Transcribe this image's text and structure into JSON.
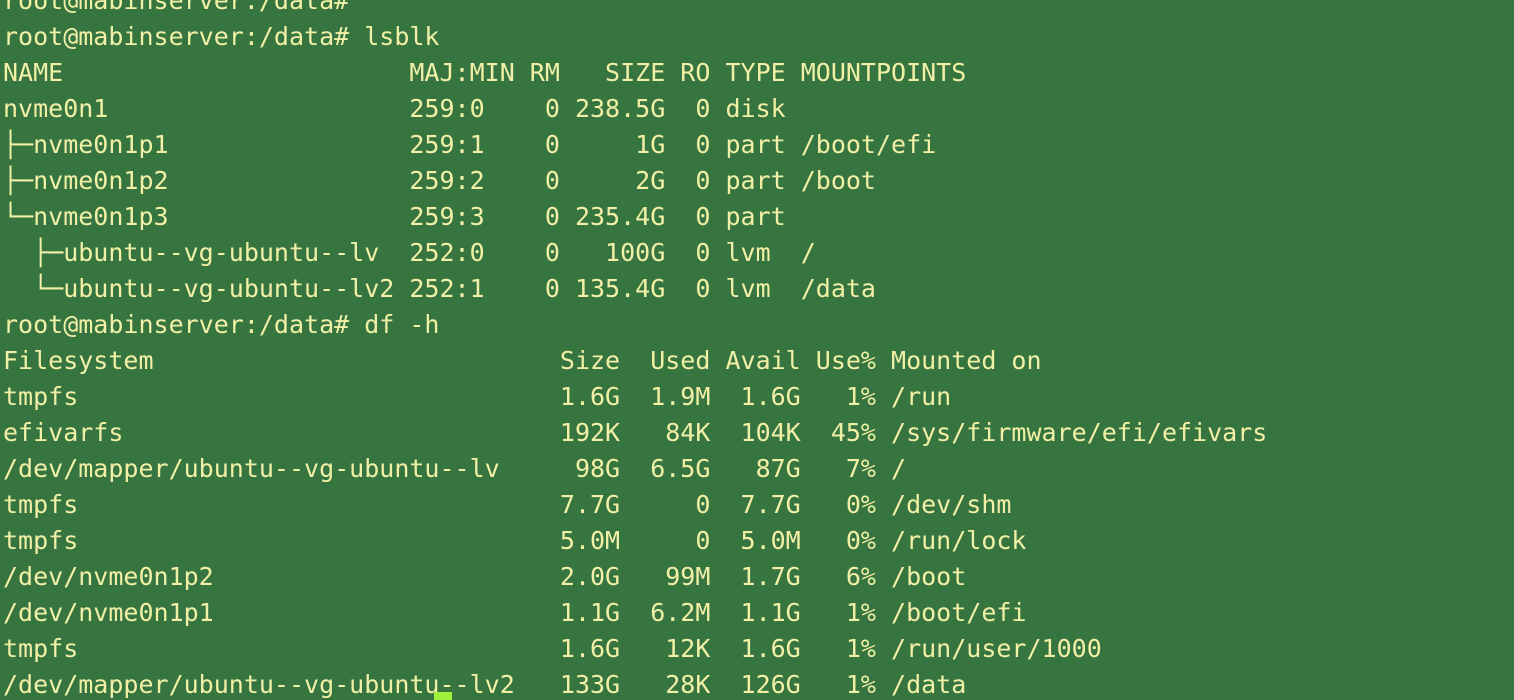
{
  "terminal": {
    "lines": [
      "root@mabinserver:/data#",
      "root@mabinserver:/data# lsblk",
      "NAME                       MAJ:MIN RM   SIZE RO TYPE MOUNTPOINTS",
      "nvme0n1                    259:0    0 238.5G  0 disk",
      "├─nvme0n1p1                259:1    0     1G  0 part /boot/efi",
      "├─nvme0n1p2                259:2    0     2G  0 part /boot",
      "└─nvme0n1p3                259:3    0 235.4G  0 part",
      "  ├─ubuntu--vg-ubuntu--lv  252:0    0   100G  0 lvm  /",
      "  └─ubuntu--vg-ubuntu--lv2 252:1    0 135.4G  0 lvm  /data",
      "root@mabinserver:/data# df -h",
      "Filesystem                           Size  Used Avail Use% Mounted on",
      "tmpfs                                1.6G  1.9M  1.6G   1% /run",
      "efivarfs                             192K   84K  104K  45% /sys/firmware/efi/efivars",
      "/dev/mapper/ubuntu--vg-ubuntu--lv     98G  6.5G   87G   7% /",
      "tmpfs                                7.7G     0  7.7G   0% /dev/shm",
      "tmpfs                                5.0M     0  5.0M   0% /run/lock",
      "/dev/nvme0n1p2                       2.0G   99M  1.7G   6% /boot",
      "/dev/nvme0n1p1                       1.1G  6.2M  1.1G   1% /boot/efi",
      "tmpfs                                1.6G   12K  1.6G   1% /run/user/1000",
      "/dev/mapper/ubuntu--vg-ubuntu--lv2   133G   28K  126G   1% /data"
    ]
  },
  "colors": {
    "background": "#367540",
    "foreground": "#f2f0a6",
    "cursor": "#9df03b"
  }
}
